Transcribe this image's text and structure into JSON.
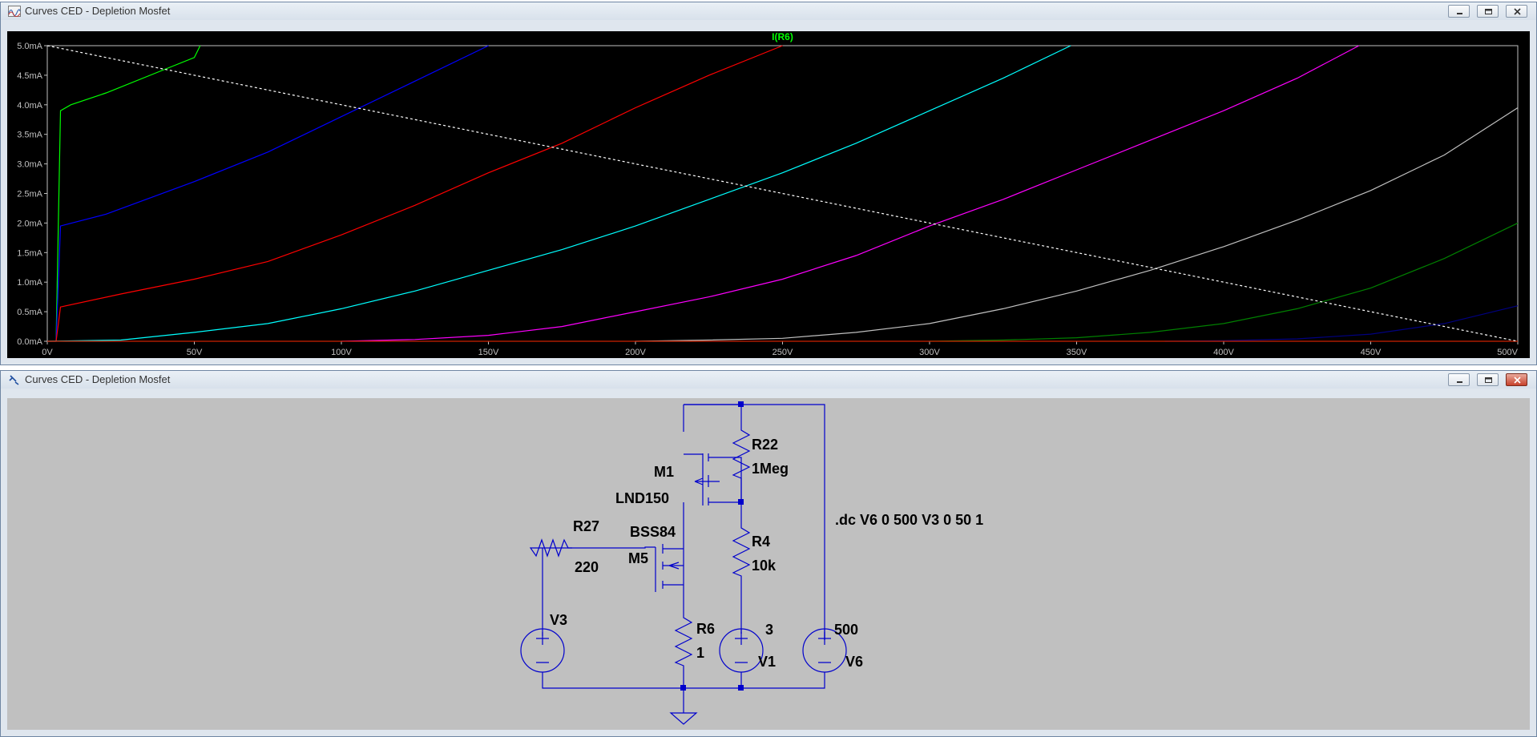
{
  "plot_window": {
    "title": "Curves CED - Depletion Mosfet",
    "trace_label": "I(R6)",
    "x_ticks": [
      "0V",
      "50V",
      "100V",
      "150V",
      "200V",
      "250V",
      "300V",
      "350V",
      "400V",
      "450V",
      "500V"
    ],
    "y_ticks": [
      "0.0mA",
      "0.5mA",
      "1.0mA",
      "1.5mA",
      "2.0mA",
      "2.5mA",
      "3.0mA",
      "3.5mA",
      "4.0mA",
      "4.5mA",
      "5.0mA"
    ]
  },
  "schematic_window": {
    "title": "Curves CED - Depletion Mosfet",
    "labels": {
      "r22_name": "R22",
      "r22_value": "1Meg",
      "m1_name": "M1",
      "m1_model": "LND150",
      "r27_name": "R27",
      "r27_value": "220",
      "m5_model": "BSS84",
      "m5_name": "M5",
      "r4_name": "R4",
      "r4_value": "10k",
      "v3_name": "V3",
      "r6_name": "R6",
      "r6_value": "1",
      "v1_value": "3",
      "v1_name": "V1",
      "v6_value": "500",
      "v6_name": "V6",
      "directive": ".dc V6 0 500  V3 0 50 1"
    }
  },
  "chart_data": {
    "type": "line",
    "title": "I(R6)",
    "xlabel": "",
    "ylabel": "",
    "xlim": [
      0,
      500
    ],
    "ylim": [
      0,
      5
    ],
    "x_unit": "V",
    "y_unit": "mA",
    "grid": false,
    "series": [
      {
        "color": "#00ff00",
        "points": [
          [
            0,
            0
          ],
          [
            3,
            0
          ],
          [
            4.5,
            3.9
          ],
          [
            8,
            4.0
          ],
          [
            20,
            4.2
          ],
          [
            40,
            4.6
          ],
          [
            50,
            4.8
          ],
          [
            52,
            5.0
          ]
        ]
      },
      {
        "color": "#0000ff",
        "points": [
          [
            0,
            0
          ],
          [
            3,
            0
          ],
          [
            4.5,
            1.95
          ],
          [
            20,
            2.15
          ],
          [
            50,
            2.7
          ],
          [
            75,
            3.2
          ],
          [
            100,
            3.8
          ],
          [
            125,
            4.4
          ],
          [
            150,
            5.0
          ]
        ]
      },
      {
        "color": "#ff0000",
        "points": [
          [
            0,
            0
          ],
          [
            3,
            0
          ],
          [
            4.5,
            0.58
          ],
          [
            25,
            0.8
          ],
          [
            50,
            1.05
          ],
          [
            75,
            1.35
          ],
          [
            100,
            1.8
          ],
          [
            125,
            2.3
          ],
          [
            150,
            2.85
          ],
          [
            175,
            3.35
          ],
          [
            200,
            3.95
          ],
          [
            225,
            4.5
          ],
          [
            250,
            5.0
          ]
        ]
      },
      {
        "color": "#00ffff",
        "points": [
          [
            0,
            0
          ],
          [
            25,
            0.02
          ],
          [
            50,
            0.15
          ],
          [
            75,
            0.3
          ],
          [
            100,
            0.55
          ],
          [
            125,
            0.85
          ],
          [
            150,
            1.2
          ],
          [
            175,
            1.55
          ],
          [
            200,
            1.95
          ],
          [
            225,
            2.4
          ],
          [
            250,
            2.85
          ],
          [
            275,
            3.35
          ],
          [
            300,
            3.9
          ],
          [
            325,
            4.45
          ],
          [
            348,
            5.0
          ]
        ]
      },
      {
        "color": "#ff00ff",
        "points": [
          [
            100,
            0
          ],
          [
            125,
            0.03
          ],
          [
            150,
            0.1
          ],
          [
            175,
            0.25
          ],
          [
            200,
            0.5
          ],
          [
            225,
            0.75
          ],
          [
            250,
            1.05
          ],
          [
            275,
            1.45
          ],
          [
            300,
            1.95
          ],
          [
            325,
            2.4
          ],
          [
            350,
            2.9
          ],
          [
            375,
            3.4
          ],
          [
            400,
            3.9
          ],
          [
            425,
            4.45
          ],
          [
            446,
            5.0
          ]
        ]
      },
      {
        "color": "#c0c0c0",
        "points": [
          [
            200,
            0
          ],
          [
            225,
            0.02
          ],
          [
            250,
            0.05
          ],
          [
            275,
            0.15
          ],
          [
            300,
            0.3
          ],
          [
            325,
            0.55
          ],
          [
            350,
            0.85
          ],
          [
            375,
            1.2
          ],
          [
            400,
            1.6
          ],
          [
            425,
            2.05
          ],
          [
            450,
            2.55
          ],
          [
            475,
            3.15
          ],
          [
            500,
            3.95
          ]
        ]
      },
      {
        "color": "#008000",
        "points": [
          [
            300,
            0
          ],
          [
            325,
            0.02
          ],
          [
            350,
            0.06
          ],
          [
            375,
            0.15
          ],
          [
            400,
            0.3
          ],
          [
            425,
            0.55
          ],
          [
            450,
            0.9
          ],
          [
            475,
            1.4
          ],
          [
            500,
            2.0
          ]
        ]
      },
      {
        "color": "#000080",
        "points": [
          [
            380,
            0
          ],
          [
            400,
            0.01
          ],
          [
            425,
            0.04
          ],
          [
            450,
            0.12
          ],
          [
            475,
            0.3
          ],
          [
            500,
            0.6
          ]
        ]
      },
      {
        "color": "#cc2200",
        "points": [
          [
            0,
            0
          ],
          [
            500,
            0
          ]
        ]
      },
      {
        "color": "#ffffff",
        "dashed": true,
        "points": [
          [
            0,
            5.0
          ],
          [
            500,
            0.0
          ]
        ]
      }
    ]
  }
}
